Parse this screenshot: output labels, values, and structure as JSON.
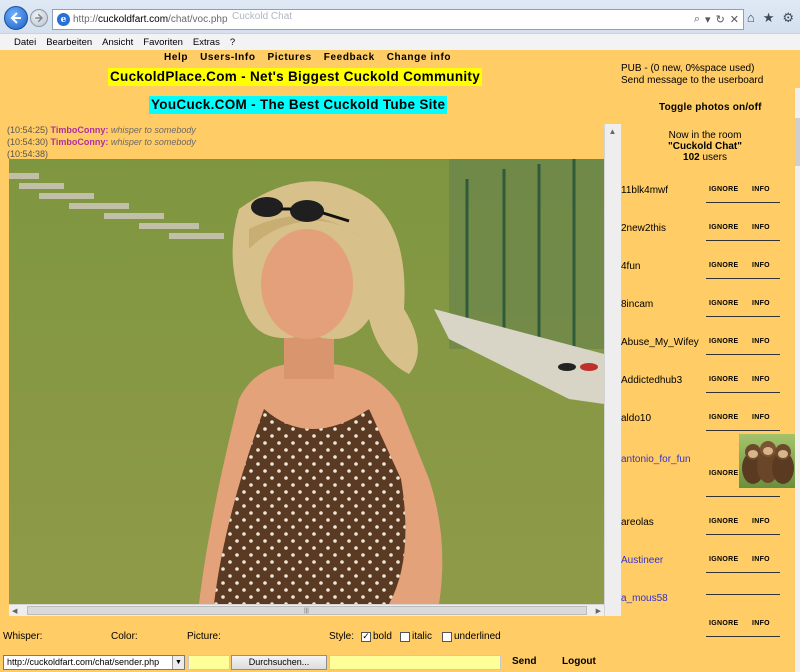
{
  "browser": {
    "url_proto": "http://",
    "url_host": "cuckoldfart.com",
    "url_path": "/chat/voc.php",
    "tab_ghost": "Cuckold Chat",
    "menu": [
      "Datei",
      "Bearbeiten",
      "Ansicht",
      "Favoriten",
      "Extras",
      "?"
    ]
  },
  "header": {
    "links": [
      "Help",
      "Users-Info",
      "Pictures",
      "Feedback",
      "Change info"
    ],
    "banner1": "CuckoldPlace.Com - Net's Biggest Cuckold Community",
    "banner2": "YouCuck.COM - The Best Cuckold Tube Site"
  },
  "messages": [
    {
      "ts": "(10:54:25)",
      "nick": "TimboConny:",
      "text": "whisper to somebody"
    },
    {
      "ts": "(10:54:30)",
      "nick": "TimboConny:",
      "text": "whisper to somebody"
    },
    {
      "ts": "(10:54:38)",
      "nick": "",
      "text": ""
    }
  ],
  "controls": {
    "whisper_label": "Whisper:",
    "color_label": "Color:",
    "picture_label": "Picture:",
    "style_label": "Style:",
    "bold_label": "bold",
    "italic_label": "italic",
    "underlined_label": "underlined",
    "bold_checked": true,
    "italic_checked": false,
    "underlined_checked": false,
    "whisper_value": "http://cuckoldfart.com/chat/sender.php",
    "browse_label": "Durchsuchen...",
    "send_label": "Send",
    "logout_label": "Logout"
  },
  "sidebar": {
    "pub_line1": "PUB - (0 new, 0%space used)",
    "pub_line2": "Send message to the userboard",
    "toggle_photos": "Toggle photos on/off",
    "room_line1": "Now in the room",
    "room_name": "\"Cuckold Chat\"",
    "user_count": "102",
    "users_suffix": "users",
    "ignore_label": "IGNORE",
    "info_label": "INFO",
    "users": [
      {
        "name": "11blk4mwf",
        "blue": false
      },
      {
        "name": "2new2this",
        "blue": false
      },
      {
        "name": "4fun",
        "blue": false
      },
      {
        "name": "8incam",
        "blue": false
      },
      {
        "name": "Abuse_My_Wifey",
        "blue": false
      },
      {
        "name": "Addictedhub3",
        "blue": false
      },
      {
        "name": "aldo10",
        "blue": false
      },
      {
        "name": "antonio_for_fun",
        "blue": true,
        "avatar": true
      },
      {
        "name": "areolas",
        "blue": false
      },
      {
        "name": "Austineer",
        "blue": true
      },
      {
        "name": "a_mous58",
        "blue": true
      },
      {
        "name": "",
        "blue": false
      }
    ]
  },
  "colors": {
    "page_bg": "#ffcc66",
    "banner1_bg": "#ffff00",
    "banner2_bg": "#00ffff",
    "nick_color": "#b0309e",
    "user_link_blue": "#3333cc"
  }
}
